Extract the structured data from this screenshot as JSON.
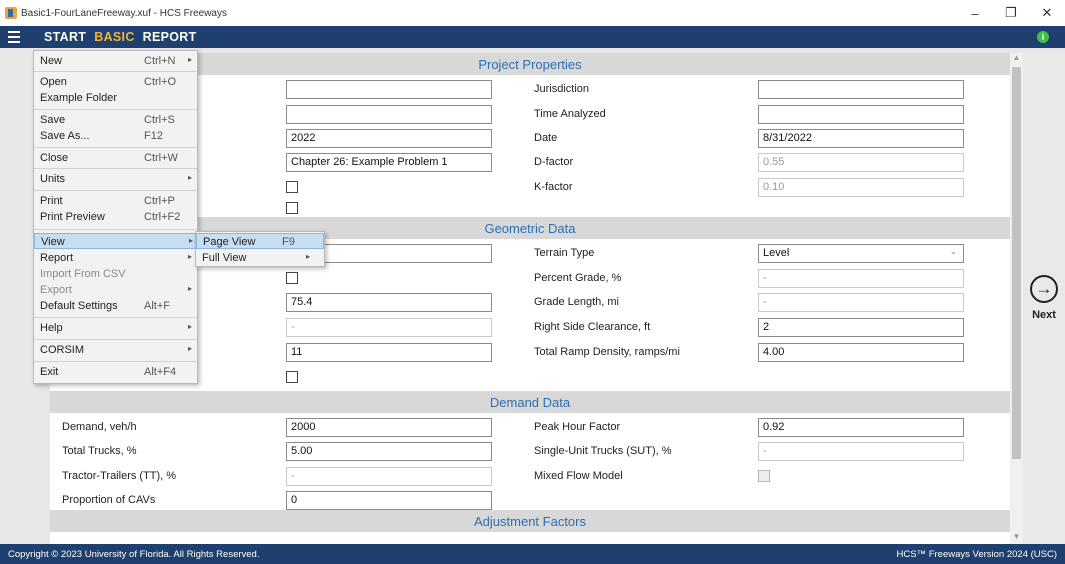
{
  "window": {
    "title": "Basic1-FourLaneFreeway.xuf - HCS Freeways",
    "minimize_glyph": "–",
    "maximize_glyph": "❐",
    "close_glyph": "✕"
  },
  "menubar": {
    "tabs": [
      {
        "label": "START",
        "active": false
      },
      {
        "label": "BASIC",
        "active": true
      },
      {
        "label": "REPORT",
        "active": false
      }
    ],
    "info_glyph": "i",
    "accent_color": "#f2b33a",
    "bar_color": "#1f3f6e"
  },
  "file_menu": {
    "items": [
      {
        "label": "New",
        "shortcut": "Ctrl+N",
        "arrow": "▸"
      },
      {
        "label": "Open",
        "shortcut": "Ctrl+O"
      },
      {
        "label": "Example Folder",
        "shortcut": ""
      },
      {
        "label": "Save",
        "shortcut": "Ctrl+S"
      },
      {
        "label": "Save As...",
        "shortcut": "F12"
      },
      {
        "label": "Close",
        "shortcut": "Ctrl+W"
      },
      {
        "label": "Units",
        "shortcut": "",
        "arrow": "▸"
      },
      {
        "label": "Print",
        "shortcut": "Ctrl+P"
      },
      {
        "label": "Print Preview",
        "shortcut": "Ctrl+F2"
      },
      {
        "label": "View",
        "shortcut": "",
        "arrow": "▸",
        "highlighted": true
      },
      {
        "label": "Report",
        "shortcut": "",
        "arrow": "▸"
      },
      {
        "label": "Import From CSV",
        "shortcut": "",
        "disabled": true
      },
      {
        "label": "Export",
        "shortcut": "",
        "arrow": "▸",
        "disabled": true
      },
      {
        "label": "Default Settings",
        "shortcut": "Alt+F"
      },
      {
        "label": "Help",
        "shortcut": "",
        "arrow": "▸"
      },
      {
        "label": "CORSIM",
        "shortcut": "",
        "arrow": "▸"
      },
      {
        "label": "Exit",
        "shortcut": "Alt+F4"
      }
    ]
  },
  "view_submenu": {
    "items": [
      {
        "label": "Page View",
        "shortcut": "F9",
        "highlighted": true
      },
      {
        "label": "Full View",
        "shortcut": "",
        "arrow": "▸"
      }
    ]
  },
  "sections": {
    "project": "Project Properties",
    "geometric": "Geometric Data",
    "demand": "Demand Data",
    "adjustment": "Adjustment Factors"
  },
  "project": {
    "left_values": [
      "",
      "",
      "2022",
      "Chapter 26: Example Problem 1"
    ],
    "right_labels": [
      "Jurisdiction",
      "Time Analyzed",
      "Date",
      "D-factor",
      "K-factor"
    ],
    "right_values": [
      "",
      "",
      "8/31/2022",
      "0.55",
      "0.10"
    ]
  },
  "geometric": {
    "left_values": [
      "",
      "",
      "75.4",
      "-",
      "11"
    ],
    "right_labels": [
      "Terrain Type",
      "Percent Grade, %",
      "Grade Length, mi",
      "Right Side Clearance, ft",
      "Total Ramp Density, ramps/mi"
    ],
    "right_values": [
      "Level",
      "-",
      "-",
      "2",
      "4.00"
    ],
    "dropdown_glyph": "⌄"
  },
  "demand": {
    "left_labels": [
      "Demand, veh/h",
      "Total Trucks, %",
      "Tractor-Trailers (TT), %",
      "Proportion of CAVs"
    ],
    "left_values": [
      "2000",
      "5.00",
      "-",
      "0"
    ],
    "right_labels": [
      "Peak Hour Factor",
      "Single-Unit Trucks (SUT), %",
      "Mixed Flow Model"
    ],
    "right_values": [
      "0.92",
      "-"
    ]
  },
  "next": {
    "label": "Next",
    "arrow_glyph": "→"
  },
  "status": {
    "copyright": "Copyright © 2023 University of Florida. All Rights Reserved.",
    "version": "HCS™ Freeways Version 2024 (USC)"
  }
}
